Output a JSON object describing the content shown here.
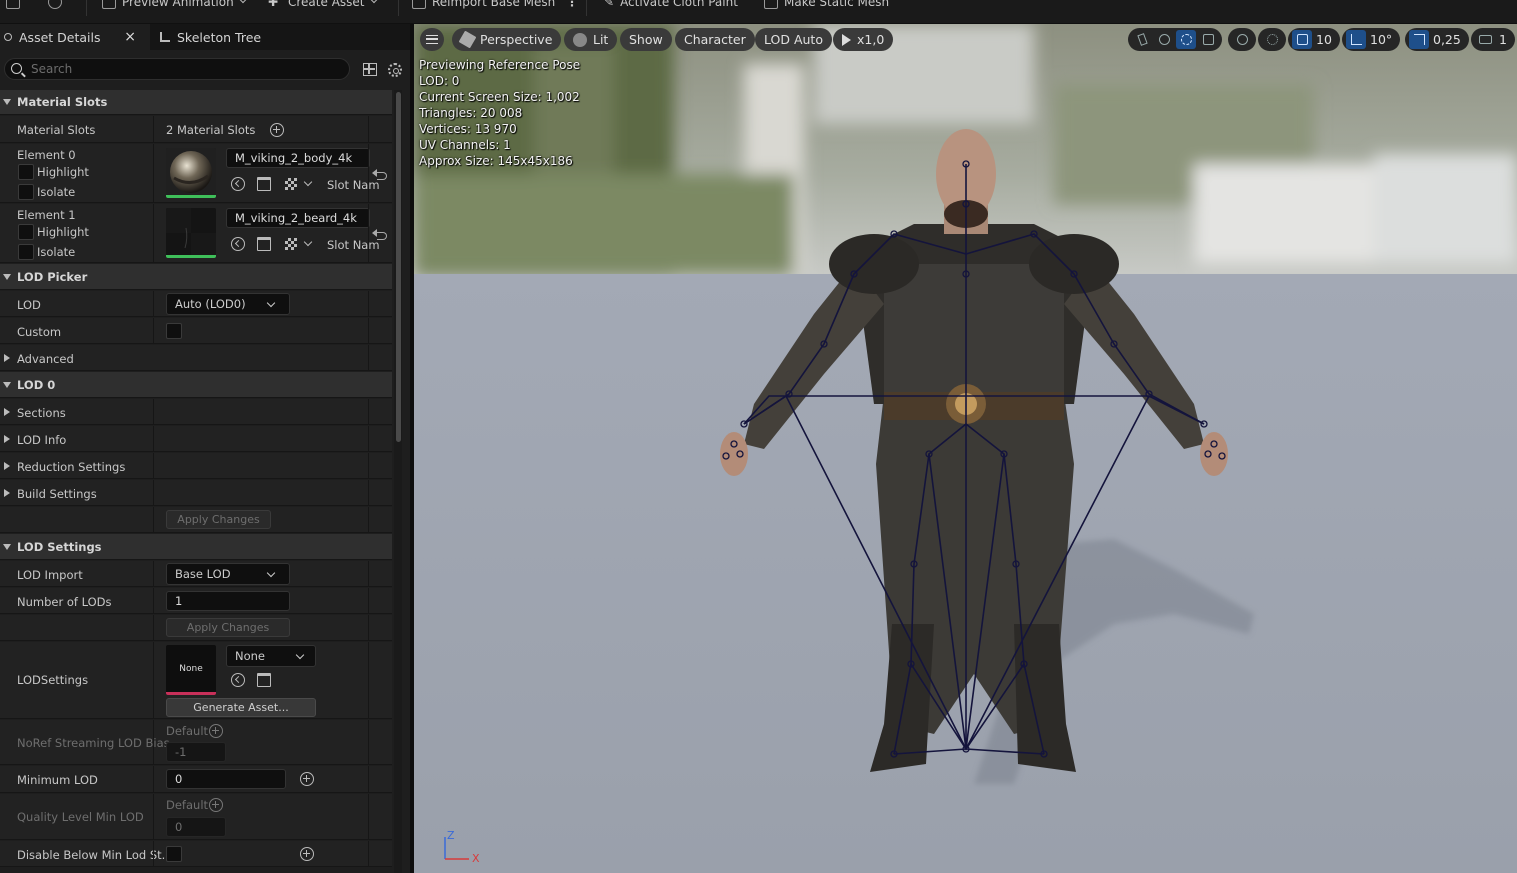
{
  "toolbar": {
    "items": [
      {
        "label": "Preview Animation",
        "has_menu": true
      },
      {
        "label": "Create Asset",
        "has_menu": true
      },
      {
        "label": "Reimport Base Mesh"
      },
      {
        "label": "Activate Cloth Paint"
      },
      {
        "label": "Make Static Mesh"
      }
    ]
  },
  "tabs": [
    {
      "label": "Asset Details",
      "active": true
    },
    {
      "label": "Skeleton Tree",
      "active": false
    }
  ],
  "search": {
    "placeholder": "Search"
  },
  "details": {
    "material_slots_section": "Material Slots",
    "material_slots_label": "Material Slots",
    "material_slots_value": "2 Material Slots",
    "element0": {
      "label": "Element 0",
      "highlight": "Highlight",
      "isolate": "Isolate",
      "material": "M_viking_2_body_4k",
      "slot_name": "Slot Nam"
    },
    "element1": {
      "label": "Element 1",
      "highlight": "Highlight",
      "isolate": "Isolate",
      "material": "M_viking_2_beard_4k",
      "slot_name": "Slot Nam"
    },
    "lod_picker_section": "LOD Picker",
    "lod_label": "LOD",
    "lod_value": "Auto (LOD0)",
    "custom_label": "Custom",
    "advanced_label": "Advanced",
    "lod0_section": "LOD 0",
    "sections_label": "Sections",
    "lod_info_label": "LOD Info",
    "reduction_label": "Reduction Settings",
    "build_label": "Build Settings",
    "apply_changes_1": "Apply Changes",
    "lod_settings_section": "LOD Settings",
    "lod_import_label": "LOD Import",
    "lod_import_value": "Base LOD",
    "num_lods_label": "Number of LODs",
    "num_lods_value": "1",
    "apply_changes_2": "Apply Changes",
    "lodsettings_label": "LODSettings",
    "lodsettings_thumb": "None",
    "lodsettings_value": "None",
    "generate_asset": "Generate Asset...",
    "noref_label": "NoRef Streaming LOD Bias",
    "noref_default": "Default",
    "noref_value": "-1",
    "min_lod_label": "Minimum LOD",
    "min_lod_value": "0",
    "quality_label": "Quality Level Min LOD",
    "quality_default": "Default",
    "quality_value": "0",
    "disable_below_label": "Disable Below Min Lod St..."
  },
  "viewport": {
    "perspective": "Perspective",
    "lit": "Lit",
    "show": "Show",
    "character": "Character",
    "lod_auto": "LOD Auto",
    "play_rate": "x1,0",
    "grid_snap": "10",
    "rot_snap": "10°",
    "scale_snap": "0,25",
    "camera_speed": "1",
    "stats": [
      "Previewing Reference Pose",
      "LOD: 0",
      "Current Screen Size: 1,002",
      "Triangles: 20 008",
      "Vertices: 13 970",
      "UV Channels: 1",
      "Approx Size: 145x45x186"
    ],
    "axis_z": "Z",
    "axis_x": "X"
  },
  "colors": {
    "accent_blue": "#1e4f8a",
    "body_bar": "#3fbf5a",
    "none_bar": "#c8305a"
  }
}
